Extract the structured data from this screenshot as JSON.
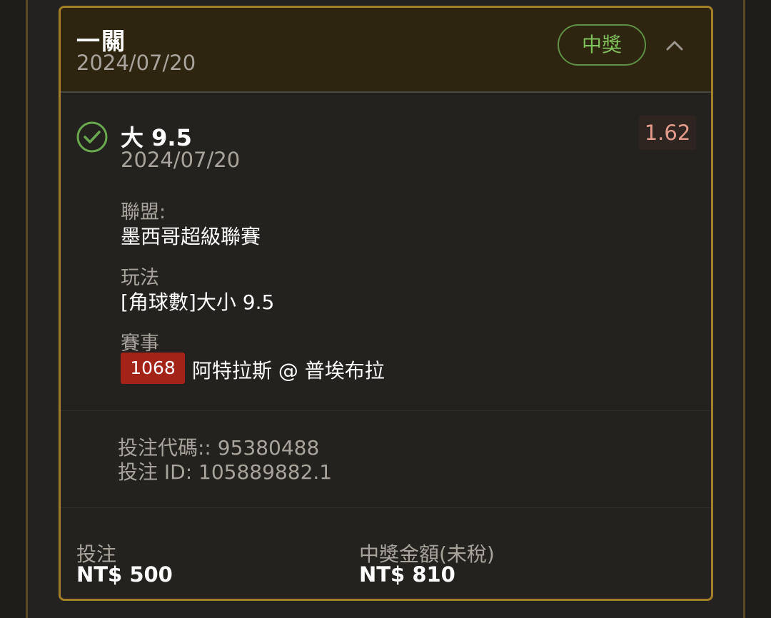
{
  "header": {
    "title": "一關",
    "date": "2024/07/20",
    "badge": "中獎"
  },
  "selection": {
    "name": "大 9.5",
    "date": "2024/07/20",
    "odds": "1.62",
    "status_icon": "check-circle-icon",
    "league_label": "聯盟:",
    "league_value": "墨西哥超級聯賽",
    "market_label": "玩法",
    "market_value": "[角球數]大小 9.5",
    "match_label": "賽事",
    "match_id": "1068",
    "match_name": "阿特拉斯 @ 普埃布拉",
    "bet_code": "投注代碼:: 95380488",
    "bet_id": "投注 ID: 105889882.1"
  },
  "footer": {
    "stake_label": "投注",
    "stake_value": "NT$ 500",
    "payout_label": "中獎金額(未稅)",
    "payout_value": "NT$ 810"
  },
  "colors": {
    "accent_border": "#a47f2a",
    "win_green": "#7fbf5c",
    "odds_red": "#e39c8c",
    "match_id_bg": "#a42318"
  }
}
